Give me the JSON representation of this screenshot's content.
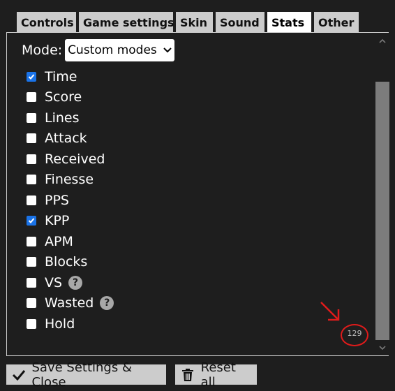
{
  "tabs": [
    {
      "label": "Controls",
      "active": false
    },
    {
      "label": "Game settings",
      "active": false
    },
    {
      "label": "Skin",
      "active": false
    },
    {
      "label": "Sound",
      "active": false
    },
    {
      "label": "Stats",
      "active": true
    },
    {
      "label": "Other",
      "active": false
    }
  ],
  "mode": {
    "label": "Mode:",
    "selected": "Custom modes"
  },
  "stats": [
    {
      "label": "Time",
      "checked": true
    },
    {
      "label": "Score",
      "checked": false
    },
    {
      "label": "Lines",
      "checked": false
    },
    {
      "label": "Attack",
      "checked": false
    },
    {
      "label": "Received",
      "checked": false
    },
    {
      "label": "Finesse",
      "checked": false
    },
    {
      "label": "PPS",
      "checked": false
    },
    {
      "label": "KPP",
      "checked": true
    },
    {
      "label": "APM",
      "checked": false
    },
    {
      "label": "Blocks",
      "checked": false
    },
    {
      "label": "VS",
      "checked": false,
      "help": "?"
    },
    {
      "label": "Wasted",
      "checked": false,
      "help": "?"
    },
    {
      "label": "Hold",
      "checked": false
    }
  ],
  "annotation": {
    "number": "129",
    "color": "#e01b1b"
  },
  "buttons": {
    "save_label": "Save Settings & Close",
    "reset_label": "Reset all"
  },
  "colors": {
    "checkbox_checked": "#1a73e8",
    "tab_bg": "#cccccc",
    "tab_active_bg": "#ffffff",
    "background": "#1e1e1e"
  }
}
